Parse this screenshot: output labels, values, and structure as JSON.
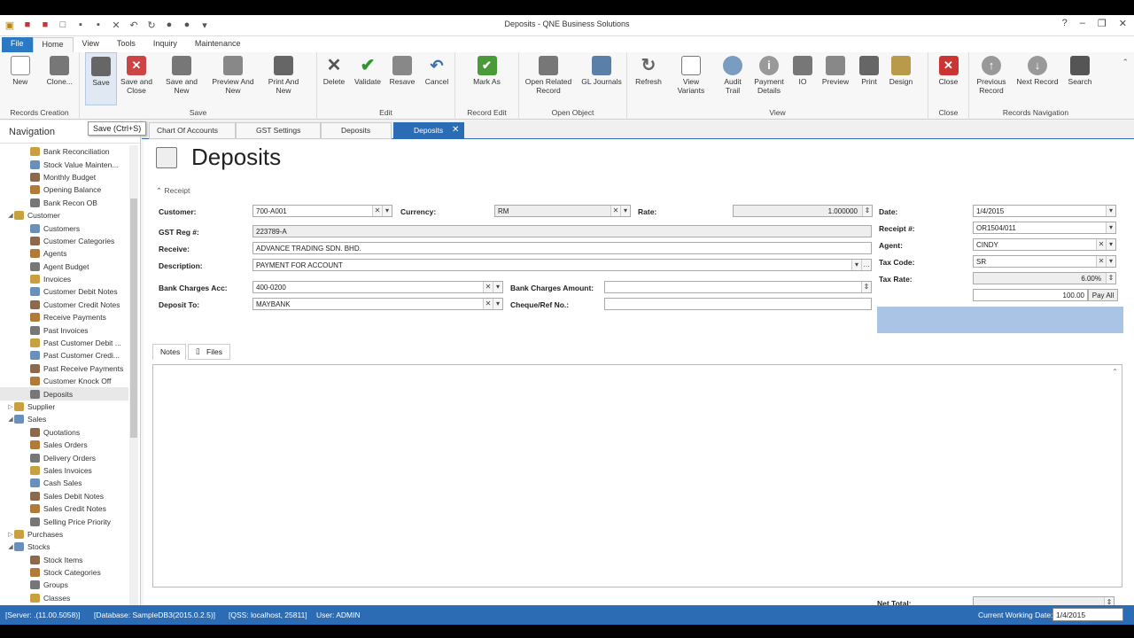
{
  "window": {
    "title": "Deposits - QNE Business Solutions"
  },
  "menu": {
    "tabs": [
      "File",
      "Home",
      "View",
      "Tools",
      "Inquiry",
      "Maintenance"
    ]
  },
  "ribbon": {
    "groups": [
      {
        "label": "Records Creation",
        "buttons": [
          "New",
          "Clone..."
        ]
      },
      {
        "label": "Save",
        "buttons": [
          "Save",
          "Save and Close",
          "Save and New",
          "Preview And New",
          "Print And New"
        ]
      },
      {
        "label": "Edit",
        "buttons": [
          "Delete",
          "Validate",
          "Resave",
          "Cancel"
        ]
      },
      {
        "label": "Record Edit",
        "buttons": [
          "Mark As"
        ]
      },
      {
        "label": "Open Object",
        "buttons": [
          "Open Related Record",
          "GL Journals"
        ]
      },
      {
        "label": "View",
        "buttons": [
          "Refresh",
          "View Variants",
          "Audit Trail",
          "Payment Details",
          "IO",
          "Preview",
          "Print",
          "Design"
        ]
      },
      {
        "label": "Close",
        "buttons": [
          "Close"
        ]
      },
      {
        "label": "Records Navigation",
        "buttons": [
          "Previous Record",
          "Next Record",
          "Search"
        ]
      }
    ]
  },
  "tooltip": "Save (Ctrl+S)",
  "nav": {
    "header": "Navigation",
    "items": [
      {
        "label": "Bank Reconciliation",
        "level": 2
      },
      {
        "label": "Stock Value Mainten...",
        "level": 2
      },
      {
        "label": "Monthly Budget",
        "level": 2
      },
      {
        "label": "Opening Balance",
        "level": 2
      },
      {
        "label": "Bank Recon OB",
        "level": 2
      },
      {
        "label": "Customer",
        "level": 1,
        "expanded": true
      },
      {
        "label": "Customers",
        "level": 2
      },
      {
        "label": "Customer Categories",
        "level": 2
      },
      {
        "label": "Agents",
        "level": 2
      },
      {
        "label": "Agent Budget",
        "level": 2
      },
      {
        "label": "Invoices",
        "level": 2
      },
      {
        "label": "Customer Debit Notes",
        "level": 2
      },
      {
        "label": "Customer Credit Notes",
        "level": 2
      },
      {
        "label": "Receive Payments",
        "level": 2
      },
      {
        "label": "Past Invoices",
        "level": 2
      },
      {
        "label": "Past Customer Debit ...",
        "level": 2
      },
      {
        "label": "Past Customer Credi...",
        "level": 2
      },
      {
        "label": "Past Receive Payments",
        "level": 2
      },
      {
        "label": "Customer Knock Off",
        "level": 2
      },
      {
        "label": "Deposits",
        "level": 2,
        "selected": true
      },
      {
        "label": "Supplier",
        "level": 1,
        "expanded": false
      },
      {
        "label": "Sales",
        "level": 1,
        "expanded": true
      },
      {
        "label": "Quotations",
        "level": 2
      },
      {
        "label": "Sales Orders",
        "level": 2
      },
      {
        "label": "Delivery Orders",
        "level": 2
      },
      {
        "label": "Sales Invoices",
        "level": 2
      },
      {
        "label": "Cash Sales",
        "level": 2
      },
      {
        "label": "Sales Debit Notes",
        "level": 2
      },
      {
        "label": "Sales Credit Notes",
        "level": 2
      },
      {
        "label": "Selling Price Priority",
        "level": 2
      },
      {
        "label": "Purchases",
        "level": 1,
        "expanded": false
      },
      {
        "label": "Stocks",
        "level": 1,
        "expanded": true
      },
      {
        "label": "Stock Items",
        "level": 2
      },
      {
        "label": "Stock Categories",
        "level": 2
      },
      {
        "label": "Groups",
        "level": 2
      },
      {
        "label": "Classes",
        "level": 2
      }
    ]
  },
  "doctabs": [
    "Chart Of Accounts",
    "GST Settings",
    "Deposits",
    "Deposits"
  ],
  "form": {
    "title": "Deposits",
    "section": "Receipt",
    "customer_label": "Customer:",
    "customer": "700-A001",
    "currency_label": "Currency:",
    "currency": "RM",
    "rate_label": "Rate:",
    "rate": "1.000000",
    "date_label": "Date:",
    "date": "1/4/2015",
    "gst_label": "GST Reg #:",
    "gst": "223789-A",
    "receipt_label": "Receipt #:",
    "receipt": "OR1504/011",
    "receive_label": "Receive:",
    "receive": "ADVANCE TRADING SDN. BHD.",
    "agent_label": "Agent:",
    "agent": "CINDY",
    "desc_label": "Description:",
    "desc": "PAYMENT FOR ACCOUNT",
    "taxcode_label": "Tax Code:",
    "taxcode": "SR",
    "bankacc_label": "Bank Charges Acc:",
    "bankacc": "400-0200",
    "bankamt_label": "Bank Charges Amount:",
    "bankamt": "",
    "taxrate_label": "Tax Rate:",
    "taxrate": "6.00%",
    "depositto_label": "Deposit To:",
    "depositto": "MAYBANK",
    "cheque_label": "Cheque/Ref No.:",
    "cheque": "",
    "amount_label": "Amount:",
    "amount": "100.00",
    "payall": "Pay All",
    "subtabs": [
      "Notes",
      "Files"
    ],
    "nettotal_label": "Net Total:",
    "nettotal": ""
  },
  "status": {
    "server": "[Server: .(11.00.5058)]",
    "database": "[Database: SampleDB3(2015.0.2.5)]",
    "qss": "[QSS: localhost, 25811]",
    "user": "User: ADMIN",
    "cwd_label": "Current Working Date:",
    "cwd": "1/4/2015"
  },
  "colors": {
    "accent": "#2b6cb5",
    "selection": "#a9c4e4"
  }
}
